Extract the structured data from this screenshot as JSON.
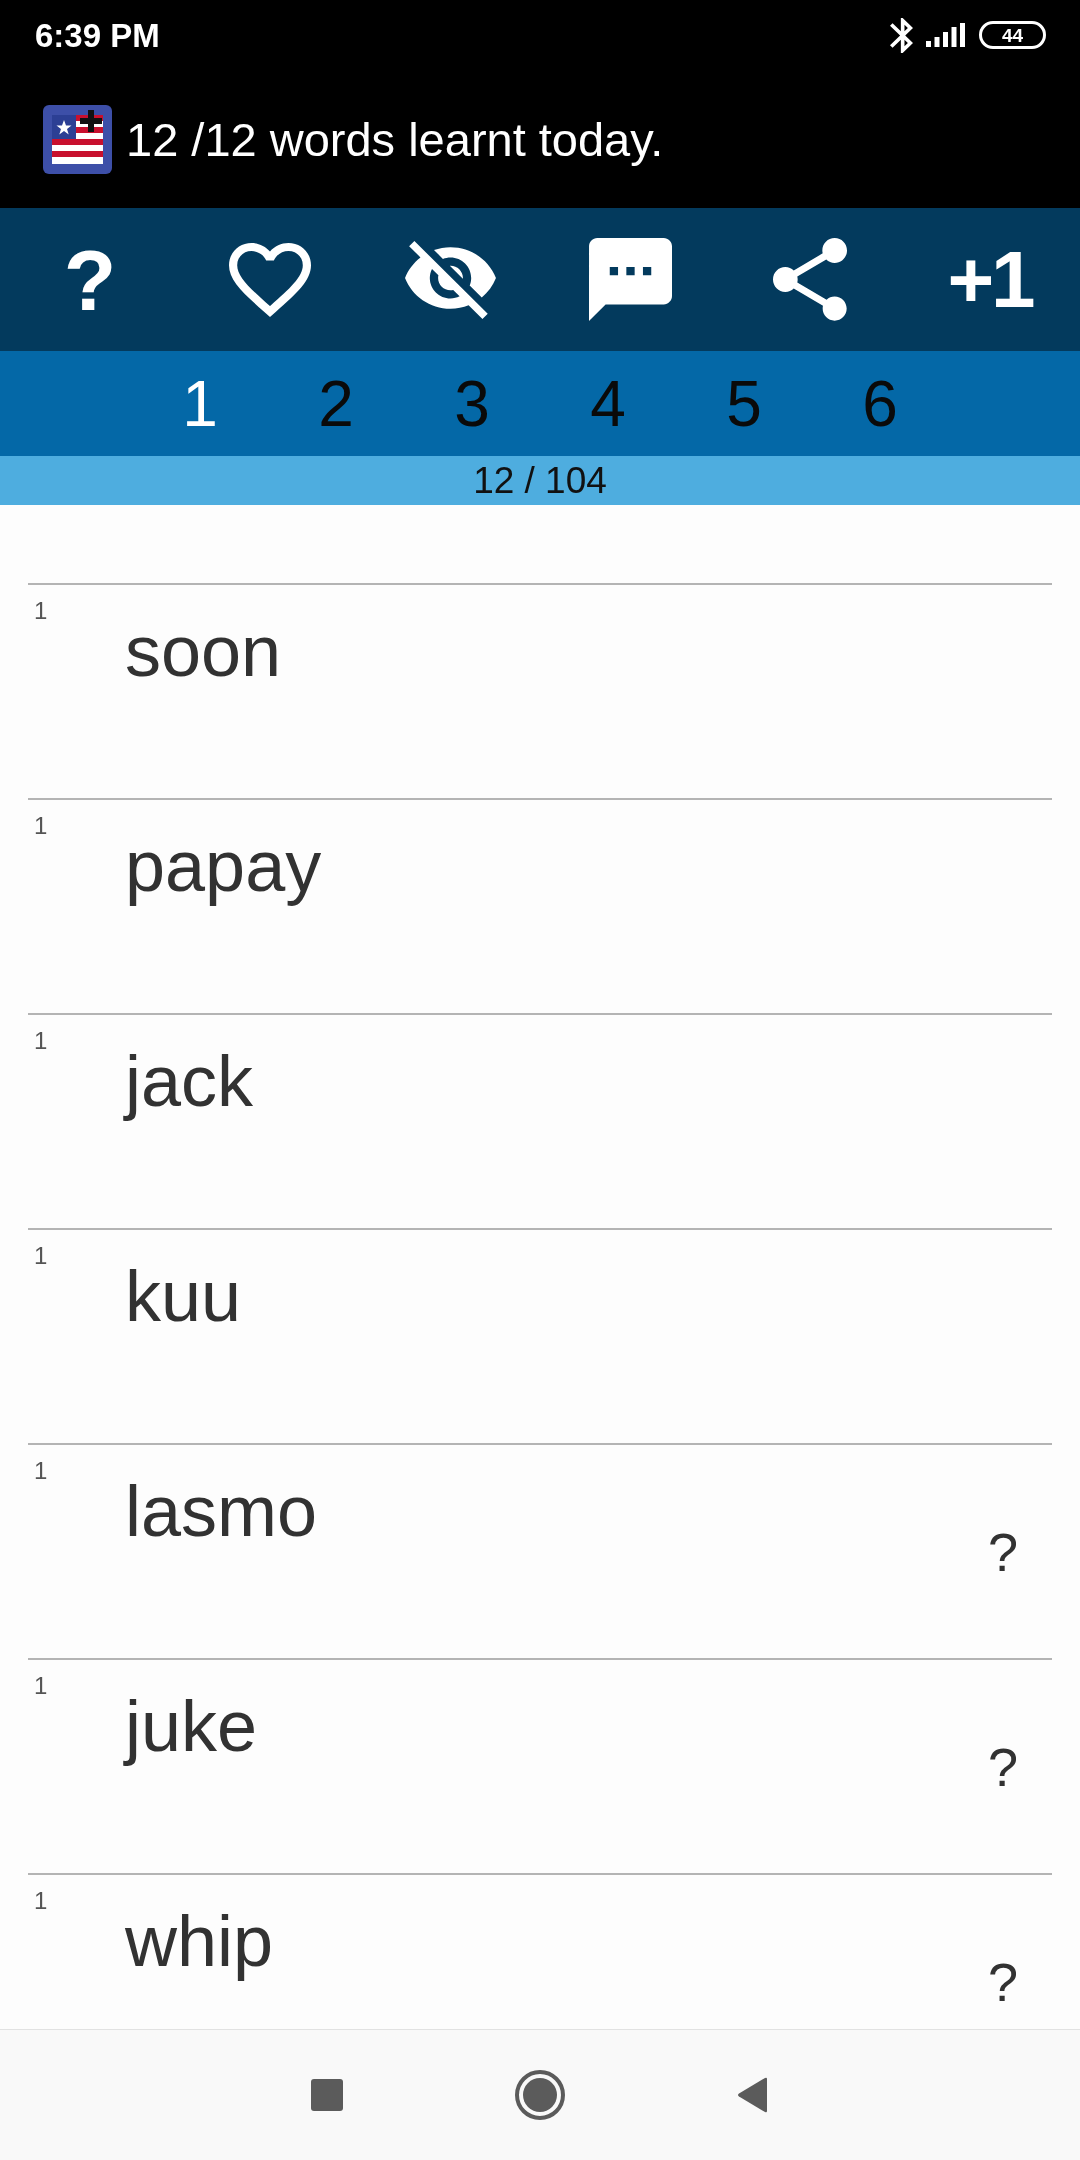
{
  "status_bar": {
    "time": "6:39 PM",
    "battery": "44"
  },
  "header": {
    "title": "12 /12 words learnt today."
  },
  "toolbar": {
    "left_label": "?",
    "right_label": "+1"
  },
  "tabs": [
    {
      "label": "1",
      "selected": true
    },
    {
      "label": "2",
      "selected": false
    },
    {
      "label": "3",
      "selected": false
    },
    {
      "label": "4",
      "selected": false
    },
    {
      "label": "5",
      "selected": false
    },
    {
      "label": "6",
      "selected": false
    }
  ],
  "counter": "12 / 104",
  "words": [
    {
      "number": "1",
      "word": "soon"
    },
    {
      "number": "1",
      "word": "papay"
    },
    {
      "number": "1",
      "word": "jack"
    },
    {
      "number": "1",
      "word": "kuu"
    },
    {
      "number": "1",
      "word": "lasmo",
      "mark": "?"
    },
    {
      "number": "1",
      "word": "juke",
      "mark": "?"
    },
    {
      "number": "1",
      "word": "whip",
      "mark": "?"
    }
  ]
}
